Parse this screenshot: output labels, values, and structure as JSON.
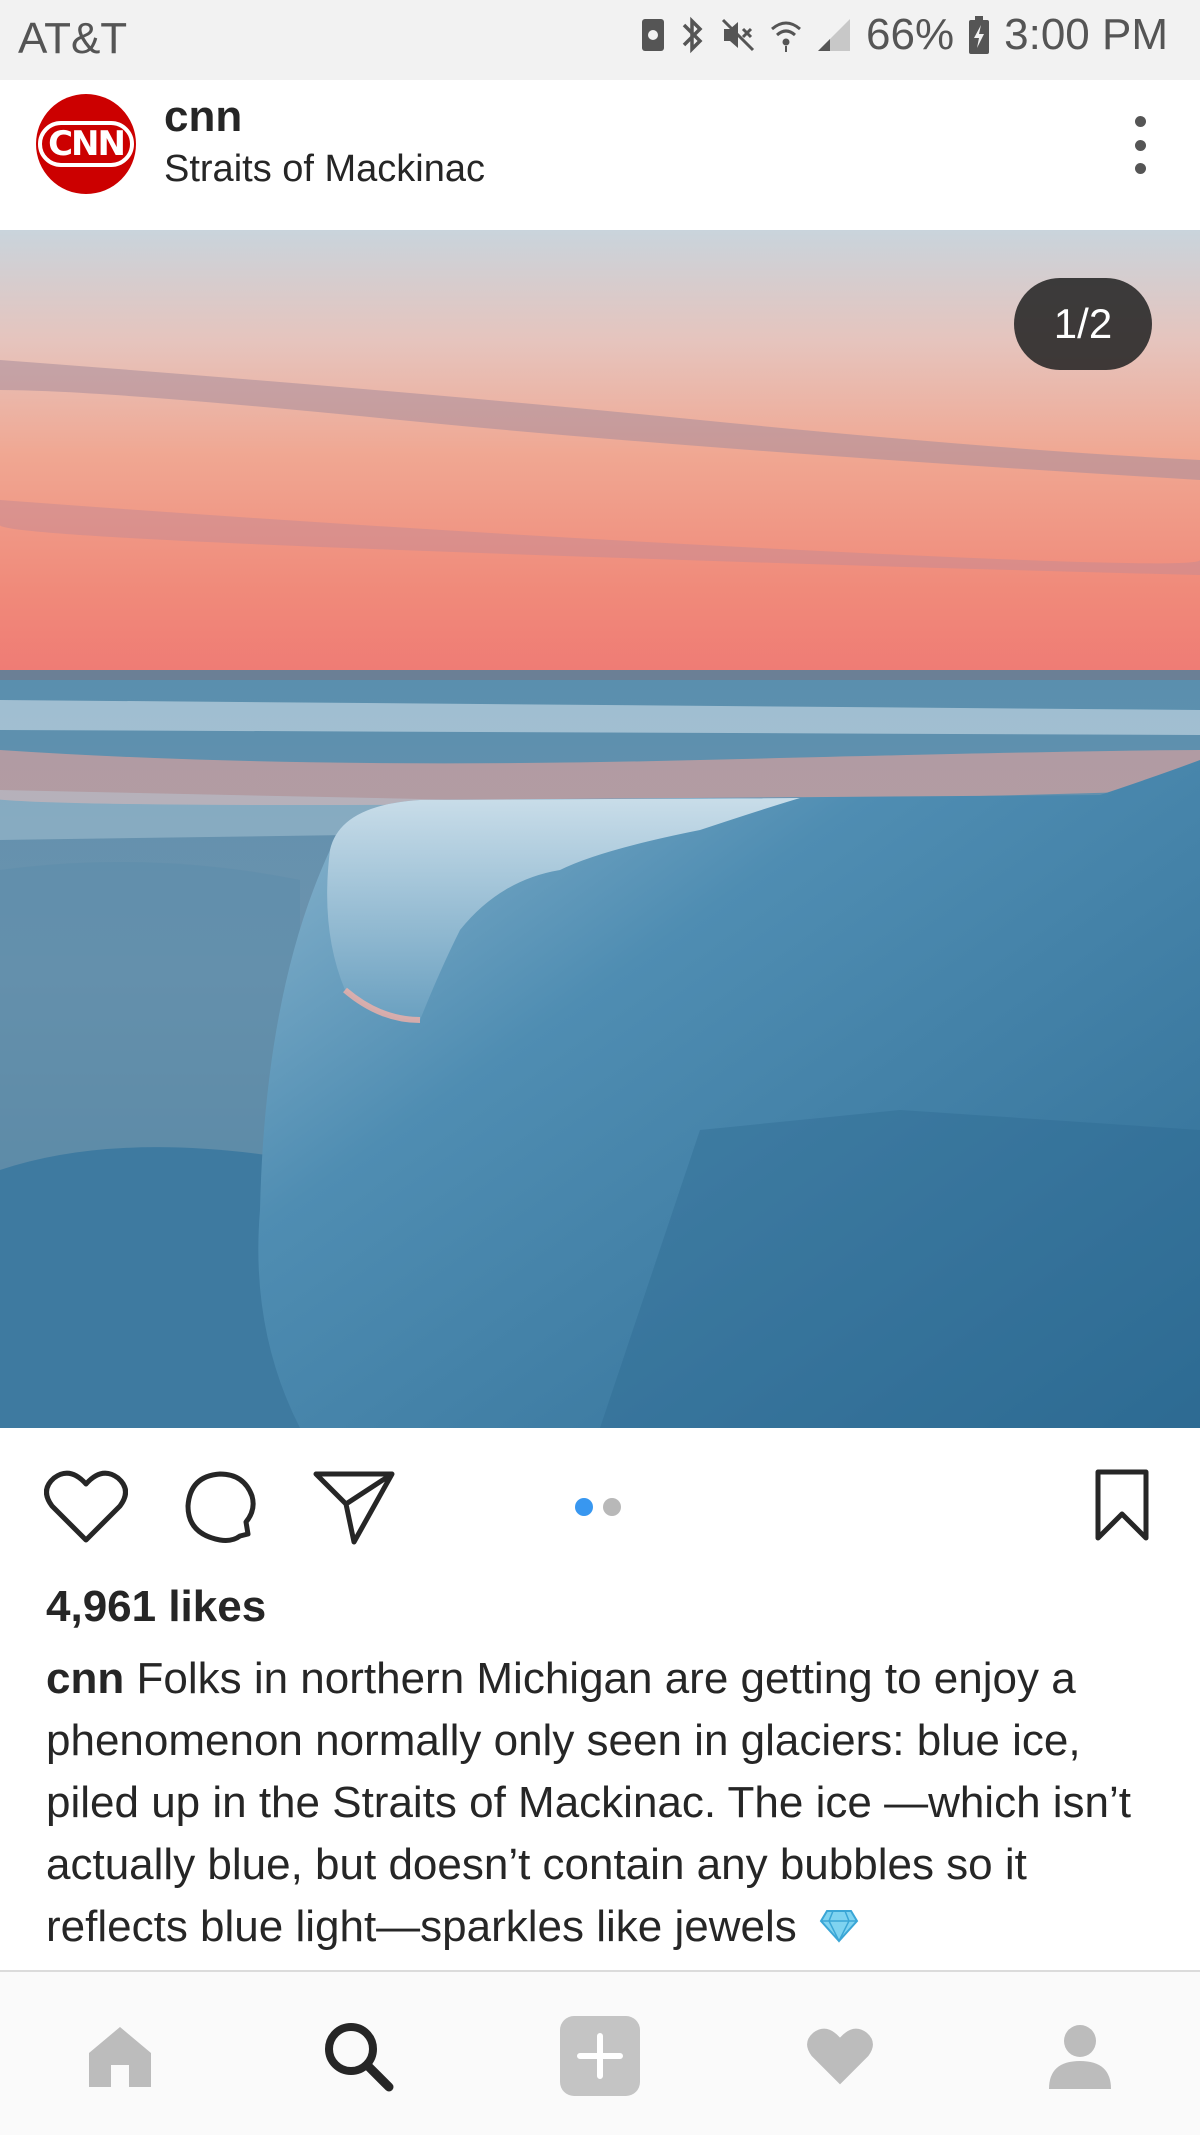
{
  "status_bar": {
    "carrier": "AT&T",
    "battery": "66%",
    "time": "3:00 PM",
    "icons": [
      "sim-icon",
      "bluetooth-icon",
      "mute-icon",
      "wifi-icon",
      "signal-icon",
      "battery-charging-icon"
    ]
  },
  "post": {
    "username": "cnn",
    "avatar_text": "CNN",
    "location": "Straits of Mackinac",
    "counter": "1/2",
    "likes": "4,961 likes",
    "caption_user": "cnn",
    "caption_text": "Folks in northern Michigan are getting to enjoy a phenomenon normally only seen in glaciers: blue ice, piled up in the Straits of Mackinac. The ice —which isn’t actually blue, but doesn’t contain any bubbles so it reflects blue light—sparkles like jewels",
    "caption_emoji": "gem-icon",
    "carousel_count": 2,
    "carousel_active": 1
  },
  "nav": {
    "items": [
      "home-icon",
      "search-icon",
      "new-post-icon",
      "activity-icon",
      "profile-icon"
    ],
    "active": "search-icon"
  },
  "colors": {
    "accent_blue": "#3897f0",
    "cnn_red": "#cc0000",
    "ice_blue": "#4a86a8"
  }
}
